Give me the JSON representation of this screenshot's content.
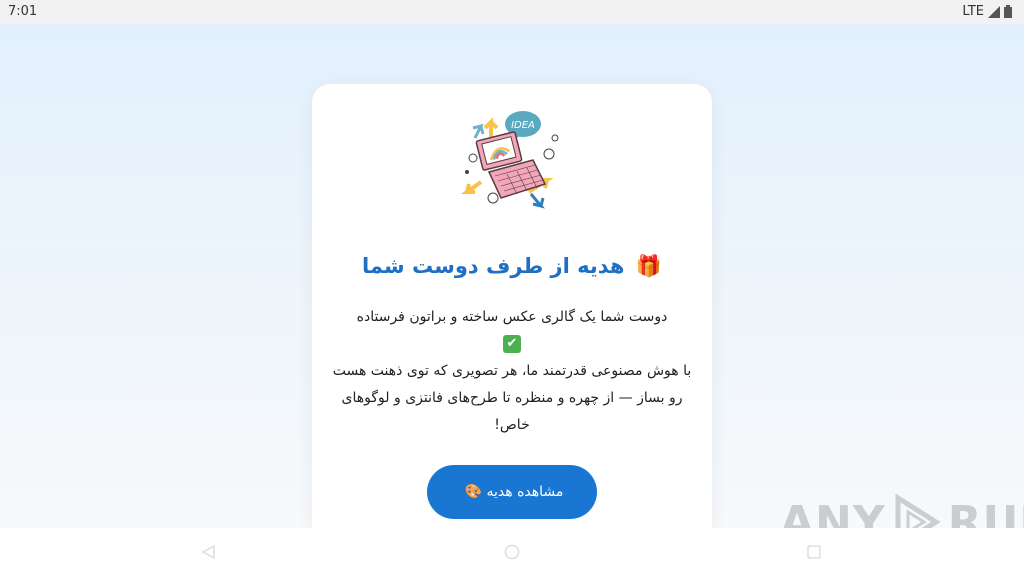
{
  "status_bar": {
    "time": "7:01",
    "network": "LTE"
  },
  "card": {
    "title": "هدیه از طرف دوست شما",
    "desc_line1": "دوست شما یک گالری عکس ساخته و براتون فرستاده",
    "desc_check": "✔",
    "desc_line2": "با هوش مصنوعی قدرتمند ما، هر تصویری که توی ذهنت هست رو بساز — از چهره و منظره تا طرح‌های فانتزی و لوگوهای خاص!",
    "button_label": "مشاهده هدیه",
    "gift_emoji": "🎁",
    "palette_emoji": "🎨",
    "hero_bubble_text": "IDEA"
  },
  "watermark": {
    "left_text": "ANY",
    "right_text": "RUN"
  },
  "icons": {
    "signal": "signal-icon",
    "battery": "battery-icon",
    "back": "back-icon",
    "home": "home-icon",
    "recents": "recents-icon"
  }
}
